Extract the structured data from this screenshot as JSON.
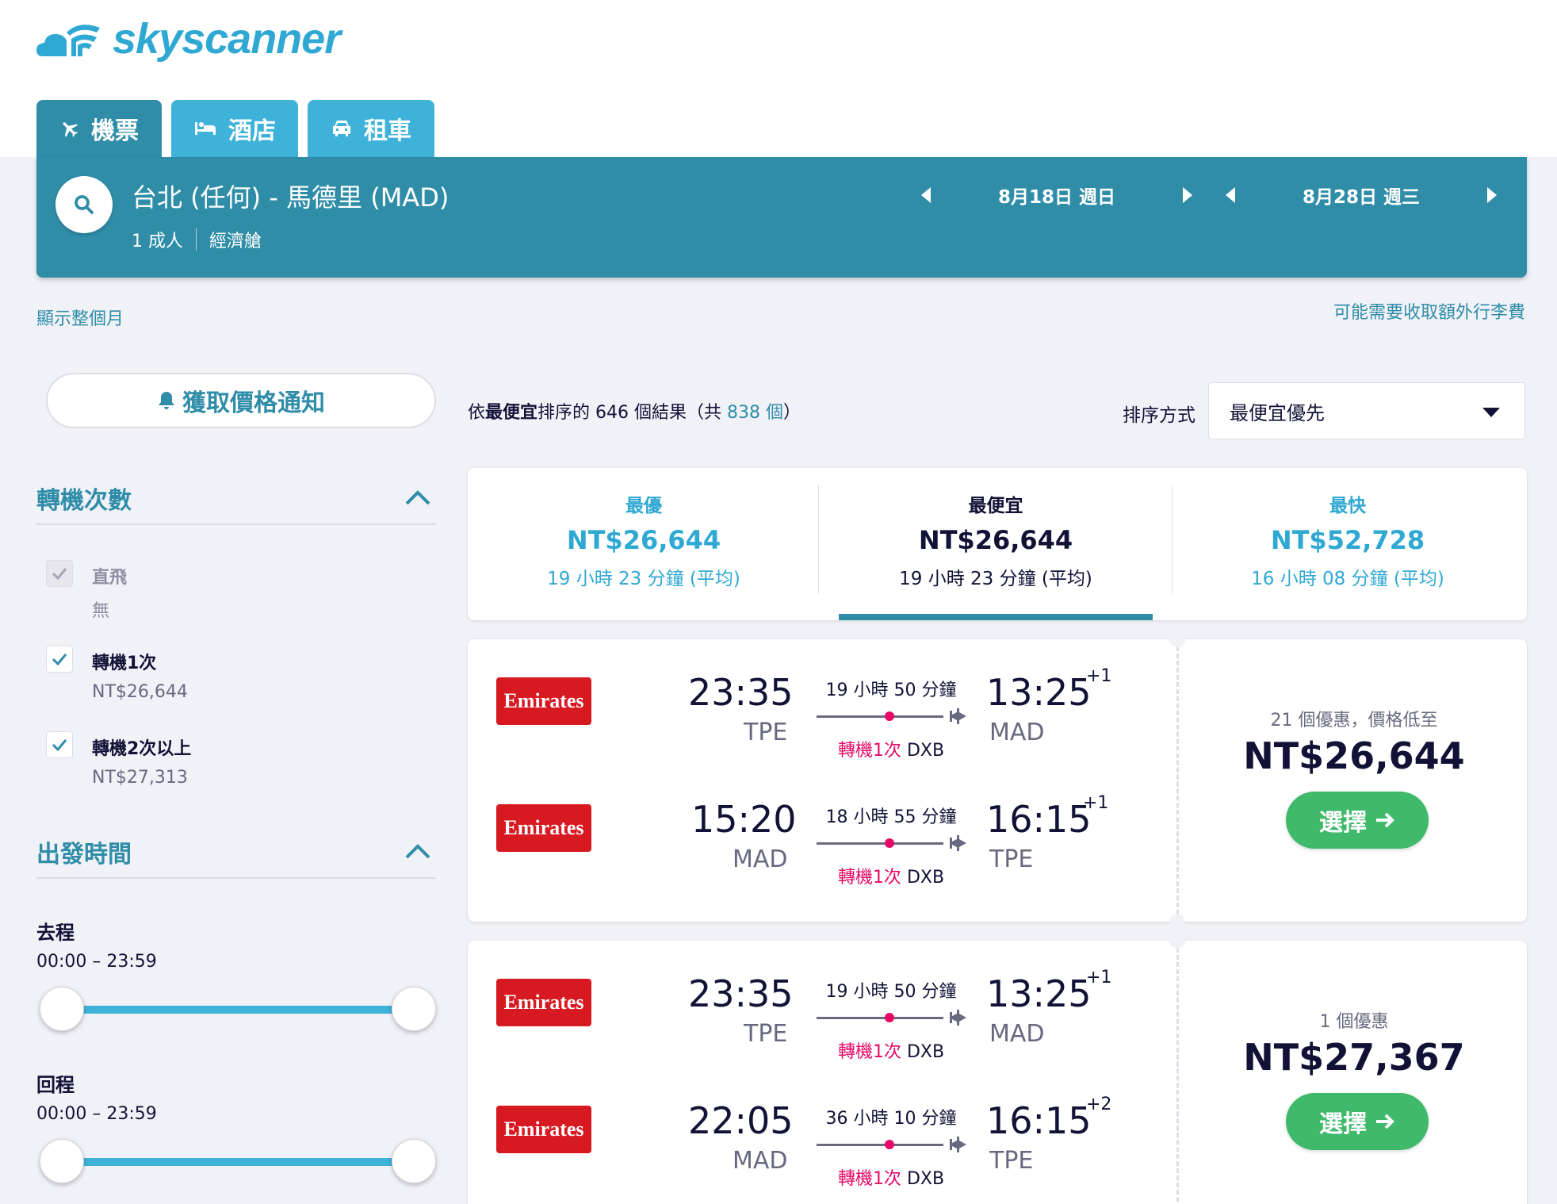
{
  "brand": {
    "name": "skyscanner"
  },
  "tabs": [
    {
      "label": "機票",
      "icon": "plane-icon"
    },
    {
      "label": "酒店",
      "icon": "bed-icon"
    },
    {
      "label": "租車",
      "icon": "car-icon"
    }
  ],
  "search": {
    "route": "台北 (任何) - 馬德里 (MAD)",
    "travelers": "1 成人",
    "cabin": "經濟艙",
    "depart_date": "8月18日 週日",
    "return_date": "8月28日 週三"
  },
  "links": {
    "show_month": "顯示整個月",
    "baggage_fee": "可能需要收取額外行李費"
  },
  "price_alert": {
    "label": "獲取價格通知"
  },
  "filters": {
    "stops": {
      "title": "轉機次數",
      "options": [
        {
          "label": "直飛",
          "sub": "無",
          "checked": true,
          "disabled": true
        },
        {
          "label": "轉機1次",
          "sub": "NT$26,644",
          "checked": true,
          "disabled": false
        },
        {
          "label": "轉機2次以上",
          "sub": "NT$27,313",
          "checked": true,
          "disabled": false
        }
      ]
    },
    "depart_time": {
      "title": "出發時間",
      "outbound": {
        "label": "去程",
        "range": "00:00 – 23:59",
        "min_fraction": 0,
        "max_fraction": 1
      },
      "return": {
        "label": "回程",
        "range": "00:00 – 23:59",
        "min_fraction": 0,
        "max_fraction": 1
      }
    }
  },
  "results": {
    "prefix": "依",
    "sort_word": "最便宜",
    "middle": "排序的 646 個結果（共 ",
    "total": "838 個",
    "suffix": "）"
  },
  "sort": {
    "label": "排序方式",
    "value": "最便宜優先"
  },
  "summary": [
    {
      "title": "最優",
      "price": "NT$26,644",
      "duration": "19 小時 23 分鐘 (平均)",
      "active": false
    },
    {
      "title": "最便宜",
      "price": "NT$26,644",
      "duration": "19 小時 23 分鐘 (平均)",
      "active": true
    },
    {
      "title": "最快",
      "price": "NT$52,728",
      "duration": "16 小時 08 分鐘 (平均)",
      "active": false
    }
  ],
  "cards": [
    {
      "legs": [
        {
          "airline": "Emirates",
          "dep_time": "23:35",
          "dep_airport": "TPE",
          "duration": "19 小時 50 分鐘",
          "stops": "轉機1次",
          "via": "DXB",
          "arr_time": "13:25",
          "arr_airport": "MAD",
          "day_offset": "+1"
        },
        {
          "airline": "Emirates",
          "dep_time": "15:20",
          "dep_airport": "MAD",
          "duration": "18 小時 55 分鐘",
          "stops": "轉機1次",
          "via": "DXB",
          "arr_time": "16:15",
          "arr_airport": "TPE",
          "day_offset": "+1"
        }
      ],
      "deals": "21 個優惠，價格低至",
      "price": "NT$26,644",
      "select_label": "選擇"
    },
    {
      "legs": [
        {
          "airline": "Emirates",
          "dep_time": "23:35",
          "dep_airport": "TPE",
          "duration": "19 小時 50 分鐘",
          "stops": "轉機1次",
          "via": "DXB",
          "arr_time": "13:25",
          "arr_airport": "MAD",
          "day_offset": "+1"
        },
        {
          "airline": "Emirates",
          "dep_time": "22:05",
          "dep_airport": "MAD",
          "duration": "36 小時 10 分鐘",
          "stops": "轉機1次",
          "via": "DXB",
          "arr_time": "16:15",
          "arr_airport": "TPE",
          "day_offset": "+2"
        }
      ],
      "deals": "1 個優惠",
      "price": "NT$27,367",
      "select_label": "選擇"
    }
  ],
  "colors": {
    "brand": "#2fa9d3",
    "header": "#2f8da8",
    "accent": "#3fb96a",
    "stops_red": "#e70866",
    "airline": "#d71921"
  }
}
